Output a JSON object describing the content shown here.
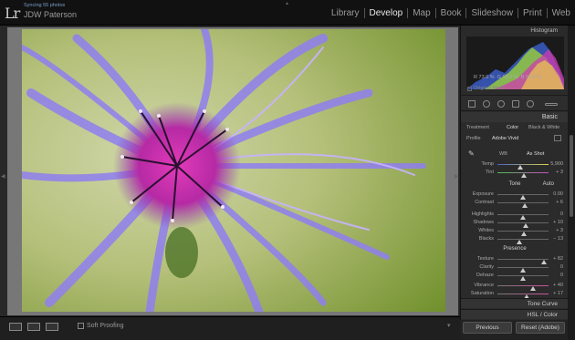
{
  "app": {
    "logo": "Lr",
    "sync_status": "Syncing 55 photos",
    "catalog_name": "JDW Paterson"
  },
  "modules": [
    "Library",
    "Develop",
    "Map",
    "Book",
    "Slideshow",
    "Print",
    "Web"
  ],
  "active_module": "Develop",
  "toolbar": {
    "soft_proofing": "Soft Proofing"
  },
  "histogram": {
    "title": "Histogram",
    "r_label": "R",
    "r_value": "73.0",
    "g_label": "G",
    "g_value": "68.2",
    "b_label": "B",
    "b_value": "92.6",
    "unit": "%",
    "original_photo": "Original Photo"
  },
  "basic": {
    "title": "Basic",
    "treatment_label": "Treatment",
    "treatment_color": "Color",
    "treatment_bw": "Black & White",
    "profile_label": "Profile",
    "profile_value": "Adobe Vivid",
    "wb_label": "WB",
    "wb_value": "As Shot",
    "temp_label": "Temp",
    "temp_value": "5,900",
    "temp_level": 0.45,
    "tint_label": "Tint",
    "tint_value": "+ 3",
    "tint_level": 0.52,
    "tone_label": "Tone",
    "tone_auto": "Auto",
    "exposure_label": "Exposure",
    "exposure_value": "0.00",
    "exposure_level": 0.5,
    "contrast_label": "Contrast",
    "contrast_value": "+ 6",
    "contrast_level": 0.53,
    "highlights_label": "Highlights",
    "highlights_value": "0",
    "highlights_level": 0.5,
    "shadows_label": "Shadows",
    "shadows_value": "+ 10",
    "shadows_level": 0.55,
    "whites_label": "Whites",
    "whites_value": "+ 3",
    "whites_level": 0.52,
    "blacks_label": "Blacks",
    "blacks_value": "− 13",
    "blacks_level": 0.43,
    "presence_label": "Presence",
    "texture_label": "Texture",
    "texture_value": "+ 82",
    "texture_level": 0.91,
    "clarity_label": "Clarity",
    "clarity_value": "0",
    "clarity_level": 0.5,
    "dehaze_label": "Dehaze",
    "dehaze_value": "0",
    "dehaze_level": 0.5,
    "vibrance_label": "Vibrance",
    "vibrance_value": "+ 40",
    "vibrance_level": 0.7,
    "saturation_label": "Saturation",
    "saturation_value": "+ 17",
    "saturation_level": 0.58
  },
  "panels": {
    "tone_curve": "Tone Curve",
    "hsl": "HSL / Color"
  },
  "buttons": {
    "previous": "Previous",
    "reset": "Reset (Adobe)"
  }
}
